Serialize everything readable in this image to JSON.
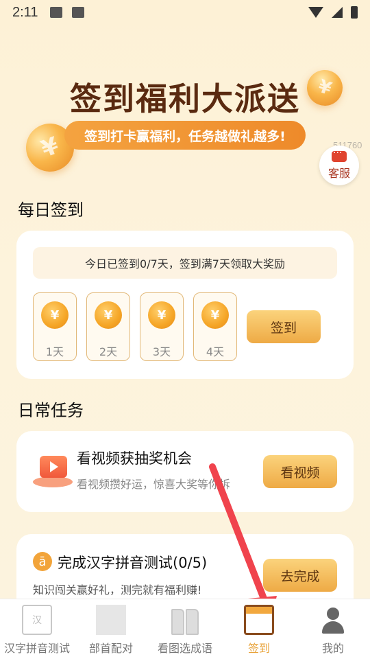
{
  "status_bar": {
    "time": "2:11"
  },
  "header": {
    "title": "签到福利大派送",
    "banner": "签到打卡赢福利，任务越做礼越多!",
    "user_id": "511760",
    "service_label": "客服"
  },
  "daily": {
    "section_title": "每日签到",
    "tip": "今日已签到0/7天，签到满7天领取大奖励",
    "coin_symbol": "¥",
    "days": [
      {
        "label": "1天"
      },
      {
        "label": "2天"
      },
      {
        "label": "3天"
      },
      {
        "label": "4天"
      }
    ],
    "button": "签到"
  },
  "tasks": {
    "section_title": "日常任务",
    "items": [
      {
        "title": "看视频获抽奖机会",
        "desc": "看视频攒好运，惊喜大奖等你拆",
        "button": "看视频"
      },
      {
        "icon_glyph": "ā",
        "title": "完成汉字拼音测试(0/5)",
        "desc": "知识闯关赢好礼，测完就有福利赚!",
        "button": "去完成"
      }
    ]
  },
  "tab_bar": {
    "items": [
      {
        "label": "汉字拼音测试",
        "icon_text": "汉"
      },
      {
        "label": "部首配对"
      },
      {
        "label": "看图选成语"
      },
      {
        "label": "签到"
      },
      {
        "label": "我的"
      }
    ],
    "active_color": "#e8a33a"
  },
  "colors": {
    "accent": "#eeaa45",
    "title": "#5a2a10",
    "annotation_arrow": "#f0434d"
  }
}
